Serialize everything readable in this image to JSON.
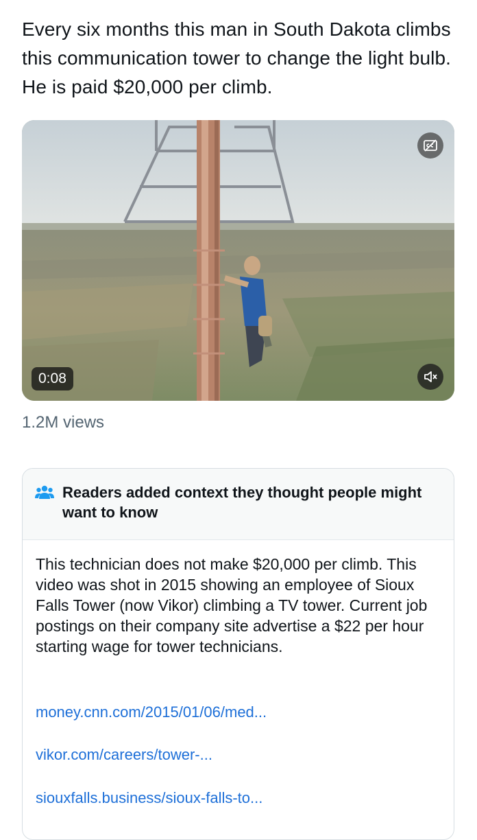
{
  "tweet": {
    "text": "Every six months this man in South Dakota climbs this communication tower to change the light bulb. He is paid $20,000 per climb."
  },
  "video": {
    "duration": "0:08",
    "cc_icon": "closed-captions-icon",
    "mute_icon": "muted-speaker-icon"
  },
  "views": "1.2M views",
  "community_note": {
    "icon": "people-group-icon",
    "title": "Readers added context they thought people might want to know",
    "body": "This technician does not make $20,000 per climb. This video was shot in 2015 showing an employee of Sioux Falls Tower (now Vikor) climbing a TV tower. Current job postings on their company site advertise a $22 per hour starting wage for tower technicians.",
    "links": [
      "money.cnn.com/2015/01/06/med...",
      "vikor.com/careers/tower-...",
      "siouxfalls.business/sioux-falls-to..."
    ],
    "link_color": "#1d6fd8",
    "icon_color": "#1d9bf0"
  }
}
